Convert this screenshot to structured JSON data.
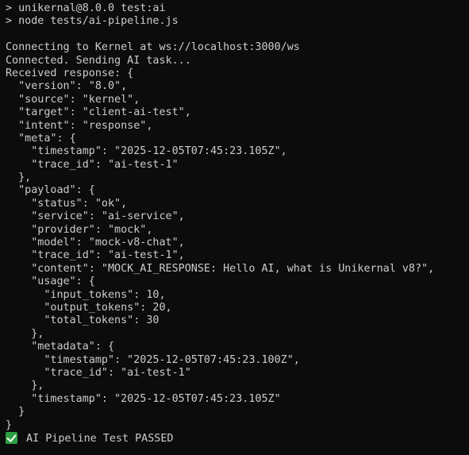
{
  "terminal": {
    "lines": [
      "> unikernal@8.0.0 test:ai",
      "> node tests/ai-pipeline.js",
      "",
      "Connecting to Kernel at ws://localhost:3000/ws",
      "Connected. Sending AI task...",
      "Received response: {",
      "  \"version\": \"8.0\",",
      "  \"source\": \"kernel\",",
      "  \"target\": \"client-ai-test\",",
      "  \"intent\": \"response\",",
      "  \"meta\": {",
      "    \"timestamp\": \"2025-12-05T07:45:23.105Z\",",
      "    \"trace_id\": \"ai-test-1\"",
      "  },",
      "  \"payload\": {",
      "    \"status\": \"ok\",",
      "    \"service\": \"ai-service\",",
      "    \"provider\": \"mock\",",
      "    \"model\": \"mock-v8-chat\",",
      "    \"trace_id\": \"ai-test-1\",",
      "    \"content\": \"MOCK_AI_RESPONSE: Hello AI, what is Unikernal v8?\",",
      "    \"usage\": {",
      "      \"input_tokens\": 10,",
      "      \"output_tokens\": 20,",
      "      \"total_tokens\": 30",
      "    },",
      "    \"metadata\": {",
      "      \"timestamp\": \"2025-12-05T07:45:23.100Z\",",
      "      \"trace_id\": \"ai-test-1\"",
      "    },",
      "    \"timestamp\": \"2025-12-05T07:45:23.105Z\"",
      "  }",
      "}"
    ],
    "passed_text": " AI Pipeline Test PASSED",
    "passed_icon": "check-mark-icon",
    "colors": {
      "background": "#0c0c0c",
      "text": "#cccccc",
      "check": "#2ea043"
    }
  }
}
